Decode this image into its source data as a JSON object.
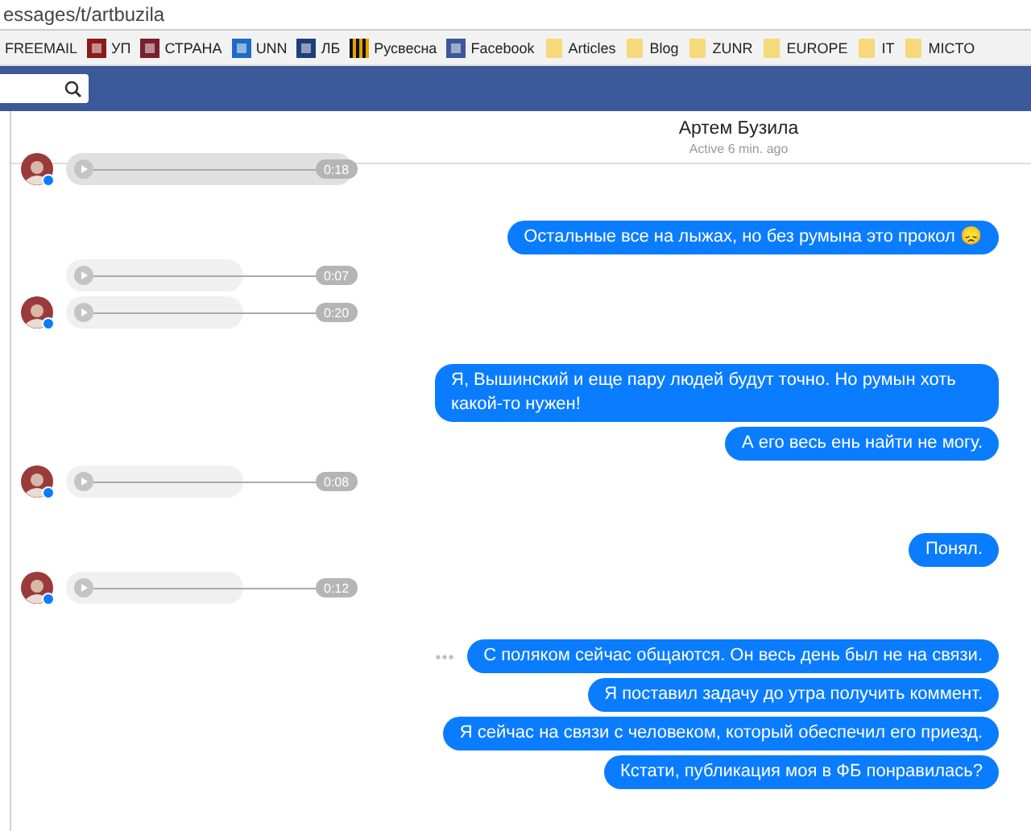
{
  "address_bar": {
    "url": "essages/t/artbuzila"
  },
  "bookmarks": [
    {
      "label": "FREEMAIL",
      "kind": "none"
    },
    {
      "label": "УП",
      "kind": "site",
      "color": "#8b1a1a"
    },
    {
      "label": "СТРАНА",
      "kind": "site",
      "color": "#7a1f2b"
    },
    {
      "label": "UNN",
      "kind": "site",
      "color": "#1e6bc4"
    },
    {
      "label": "ЛБ",
      "kind": "site",
      "color": "#1f3f7a"
    },
    {
      "label": "Русвесна",
      "kind": "ribbon",
      "color": "#e8a000"
    },
    {
      "label": "Facebook",
      "kind": "site",
      "color": "#3b5998"
    },
    {
      "label": "Articles",
      "kind": "folder"
    },
    {
      "label": "Blog",
      "kind": "folder"
    },
    {
      "label": "ZUNR",
      "kind": "folder"
    },
    {
      "label": "EUROPE",
      "kind": "folder"
    },
    {
      "label": "IT",
      "kind": "folder"
    },
    {
      "label": "MICTO",
      "kind": "folder"
    }
  ],
  "conversation": {
    "name": "Артем Бузила",
    "status": "Active 6 min. ago"
  },
  "messages": [
    {
      "kind": "voice",
      "duration": "0:18",
      "active": true,
      "avatar": true
    },
    {
      "kind": "text",
      "text": "Остальные все на лыжах, но без румына это прокол 😞",
      "options": false,
      "gap": true
    },
    {
      "kind": "voice",
      "duration": "0:07",
      "active": false,
      "avatar": false
    },
    {
      "kind": "voice",
      "duration": "0:20",
      "active": false,
      "avatar": true
    },
    {
      "kind": "text",
      "text": "Я, Вышинский и еще пару людей будут точно. Но румын хоть какой-то нужен!",
      "options": false,
      "gap": true
    },
    {
      "kind": "text",
      "text": "А его весь ень найти не могу.",
      "options": false,
      "gap": false
    },
    {
      "kind": "voice",
      "duration": "0:08",
      "active": false,
      "avatar": true
    },
    {
      "kind": "text",
      "text": "Понял.",
      "options": false,
      "gap": true
    },
    {
      "kind": "voice",
      "duration": "0:12",
      "active": false,
      "avatar": true
    },
    {
      "kind": "text",
      "text": "С поляком сейчас общаются. Он весь день был не на связи.",
      "options": true,
      "gap": true
    },
    {
      "kind": "text",
      "text": "Я поставил задачу до утра получить коммент.",
      "options": false,
      "gap": false
    },
    {
      "kind": "text",
      "text": "Я сейчас на связи с человеком, который обеспечил его приезд.",
      "options": false,
      "gap": false
    },
    {
      "kind": "text",
      "text": "Кстати, публикация моя в ФБ понравилась?",
      "options": false,
      "gap": false
    }
  ]
}
